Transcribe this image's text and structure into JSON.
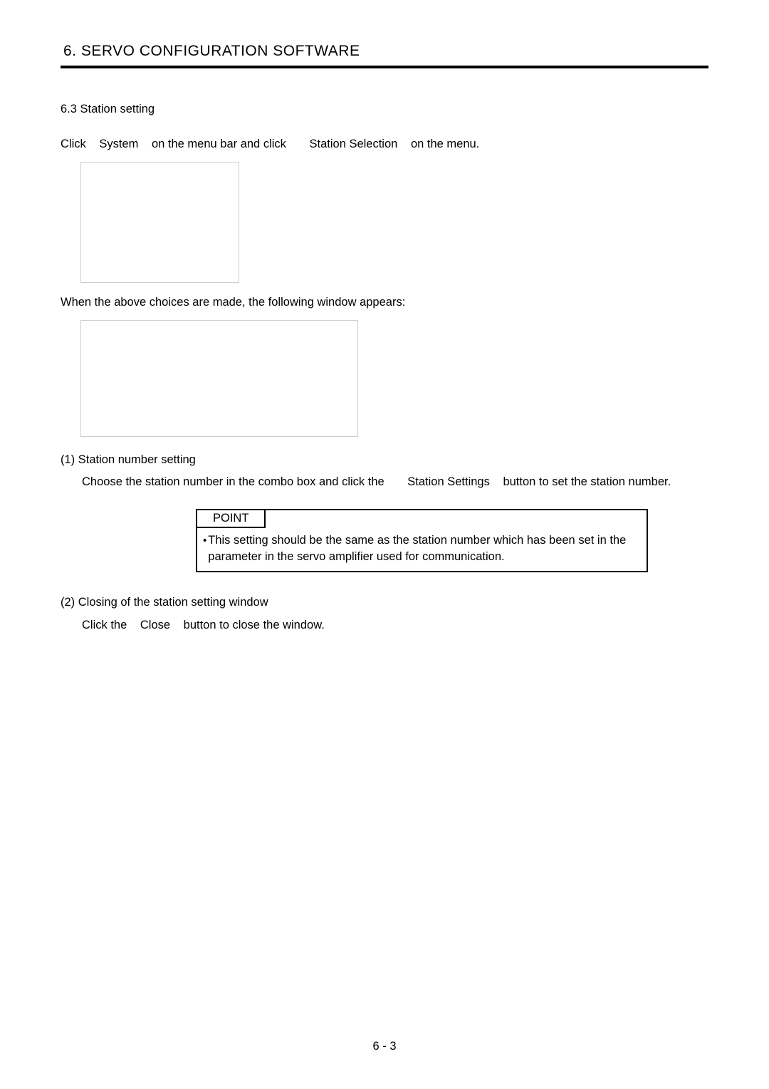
{
  "chapter_title": "6. SERVO CONFIGURATION SOFTWARE",
  "section_heading": "6.3 Station setting",
  "intro_instruction": {
    "p1": "Click",
    "p2": "System",
    "p3": "on the menu bar and click",
    "p4": "Station Selection",
    "p5": "on the menu."
  },
  "after_image_text": "When the above choices are made, the following window appears:",
  "item1": {
    "heading": "(1) Station number setting",
    "body_p1": "Choose the station number in the combo box and click the",
    "body_p2": "Station Settings",
    "body_p3": "button to set the station number."
  },
  "point": {
    "label": "POINT",
    "body": "This setting should be the same as the station number which has been set in the parameter in the servo amplifier used for communication."
  },
  "item2": {
    "heading": "(2) Closing of the station setting window",
    "body_p1": "Click the",
    "body_p2": "Close",
    "body_p3": "button to close the window."
  },
  "page_number": "6 -  3"
}
